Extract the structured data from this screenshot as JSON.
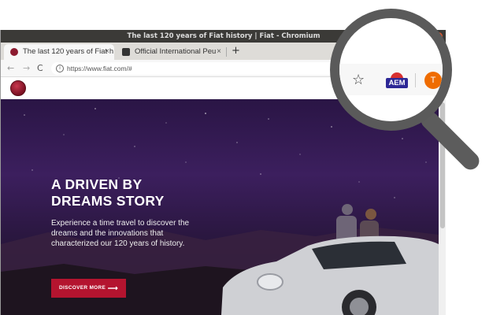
{
  "window": {
    "title": "The last 120 years of Fiat history | Fiat - Chromium"
  },
  "tabs": [
    {
      "label": "The last 120 years of Fiat h",
      "close": "×"
    },
    {
      "label": "Official International Peu",
      "close": "×"
    }
  ],
  "toolbar": {
    "back": "←",
    "forward": "→",
    "reload": "C",
    "url": "https://www.fiat.com/#",
    "new_tab": "+"
  },
  "hero": {
    "title_line1": "A DRIVEN BY",
    "title_line2": "DREAMS STORY",
    "body": "Experience a time travel to discover the dreams and the innovations that characterized our 120 years of history.",
    "cta_label": "DISCOVER MORE",
    "cta_arrow": "⟶"
  },
  "magnifier": {
    "star_icon": "☆",
    "extension_label": "AEM",
    "avatar_letter": "T"
  },
  "colors": {
    "brand_red": "#b4142f",
    "hero_purple": "#3c1f5e",
    "aem_blue": "#2d2896",
    "avatar_orange": "#ef6c00"
  }
}
